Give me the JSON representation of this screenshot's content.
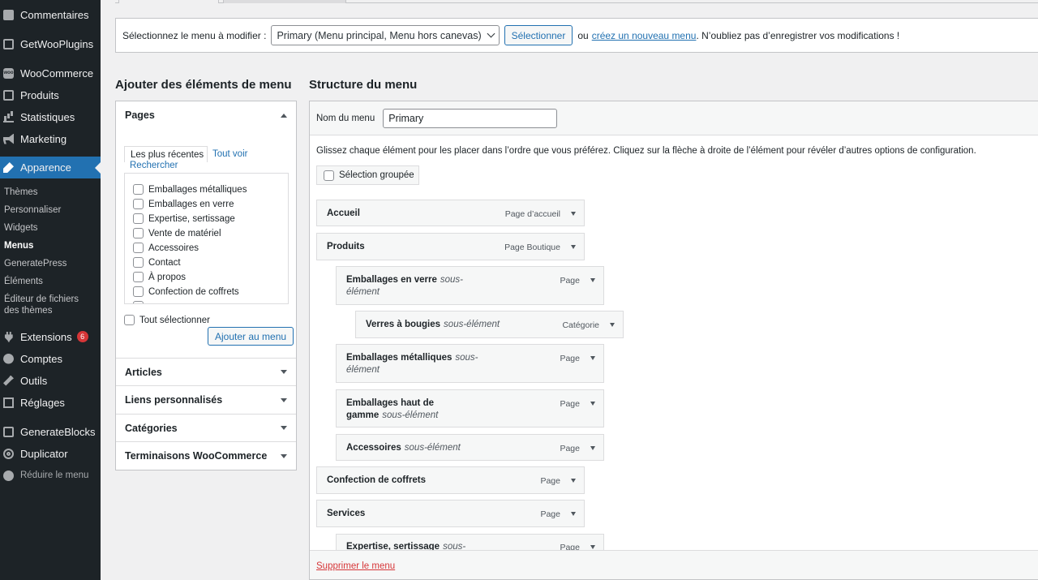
{
  "sidebar": {
    "items": [
      {
        "label": "Commentaires",
        "icon": "comments-icon"
      },
      {
        "label": "GetWooPlugins",
        "icon": "plugin-box-icon"
      },
      {
        "label": "WooCommerce",
        "icon": "woocommerce-icon"
      },
      {
        "label": "Produits",
        "icon": "products-icon"
      },
      {
        "label": "Statistiques",
        "icon": "statistics-icon"
      },
      {
        "label": "Marketing",
        "icon": "megaphone-icon"
      },
      {
        "label": "Apparence",
        "icon": "brush-icon"
      },
      {
        "label": "Extensions",
        "icon": "plugin-icon",
        "badge": "6"
      },
      {
        "label": "Comptes",
        "icon": "user-icon"
      },
      {
        "label": "Outils",
        "icon": "wrench-icon"
      },
      {
        "label": "Réglages",
        "icon": "settings-icon"
      },
      {
        "label": "GenerateBlocks",
        "icon": "generateblocks-icon"
      },
      {
        "label": "Duplicator",
        "icon": "duplicator-icon"
      },
      {
        "label": "Réduire le menu",
        "icon": "collapse-icon"
      }
    ],
    "submenu": [
      "Thèmes",
      "Personnaliser",
      "Widgets",
      "Menus",
      "GeneratePress",
      "Éléments",
      "Éditeur de fichiers des thèmes"
    ]
  },
  "manage": {
    "label": "Sélectionnez le menu à modifier :",
    "selected_menu": "Primary (Menu principal, Menu hors canevas)",
    "select_button": "Sélectionner",
    "or": "ou",
    "create_link": "créez un nouveau menu",
    "reminder": ". N’oubliez pas d’enregistrer vos modifications !"
  },
  "left": {
    "title": "Ajouter des éléments de menu",
    "pages_heading": "Pages",
    "tabs": [
      "Les plus récentes",
      "Tout voir",
      "Rechercher"
    ],
    "pages": [
      "Emballages métalliques",
      "Emballages en verre",
      "Expertise, sertissage",
      "Vente de matériel",
      "Accessoires",
      "Contact",
      "À propos",
      "Confection de coffrets"
    ],
    "select_all": "Tout sélectionner",
    "add_button": "Ajouter au menu",
    "sections": [
      "Articles",
      "Liens personnalisés",
      "Catégories",
      "Terminaisons WooCommerce"
    ]
  },
  "right": {
    "title": "Structure du menu",
    "name_label": "Nom du menu",
    "name_value": "Primary",
    "instructions": "Glissez chaque élément pour les placer dans l’ordre que vous préférez. Cliquez sur la flèche à droite de l’élément pour révéler d’autres options de configuration.",
    "bulk_select": "Sélection groupée",
    "items": [
      {
        "title": "Accueil",
        "sub": "",
        "type": "Page d’accueil"
      },
      {
        "title": "Produits",
        "sub": "",
        "type": "Page Boutique"
      },
      {
        "title": "Emballages en verre",
        "sub": "sous-élément",
        "type": "Page"
      },
      {
        "title": "Verres à bougies",
        "sub": "sous-élément",
        "type": "Catégorie"
      },
      {
        "title": "Emballages métalliques",
        "sub": "sous-élément",
        "type": "Page"
      },
      {
        "title": "Emballages haut de gamme",
        "sub": "sous-élément",
        "type": "Page"
      },
      {
        "title": "Accessoires",
        "sub": "sous-élément",
        "type": "Page"
      },
      {
        "title": "Confection de coffrets",
        "sub": "",
        "type": "Page"
      },
      {
        "title": "Services",
        "sub": "",
        "type": "Page"
      },
      {
        "title": "Expertise, sertissage",
        "sub": "sous-",
        "type": "Page"
      }
    ],
    "delete_link": "Supprimer le menu"
  },
  "colors": {
    "sidebar_bg": "#1d2327",
    "accent": "#2271b1",
    "danger": "#d63638"
  }
}
